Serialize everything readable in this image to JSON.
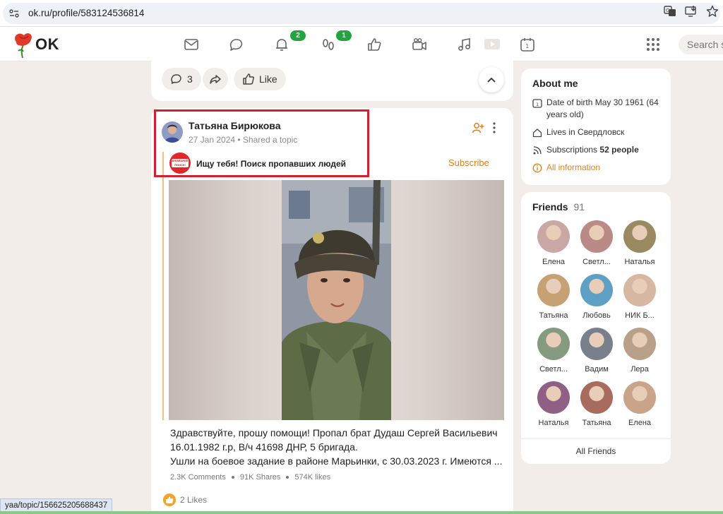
{
  "browser": {
    "url": "ok.ru/profile/583124536814",
    "status_url": "yaa/topic/156625205688437"
  },
  "header": {
    "logo_text": "OK",
    "badges": {
      "notifications": "2",
      "guests": "1"
    },
    "search_placeholder": "Search s"
  },
  "prev_post": {
    "comments_count": "3",
    "like_label": "Like"
  },
  "post": {
    "author": "Татьяна Бирюкова",
    "meta": "27 Jan 2024 • Shared a topic",
    "group_name": "Ищу тебя! Поиск пропавших людей",
    "group_avatar_text": "ВНИМАНИЕ ПОИСК!",
    "subscribe_label": "Subscribe",
    "text_lines": [
      "Здравствуйте,  прошу помощи! Пропал брат Дудаш Сергей Васильевич",
      "16.01.1982 г.р,  В/ч 41698 ДНР, 5 бригада.",
      "Ушли на боевое задание в районе Марьинки, с 30.03.2023 г. Имеются ..."
    ],
    "comments": "2.3K Comments",
    "shares": "91K Shares",
    "likes_stat": "574K likes",
    "likes_count": "2 Likes"
  },
  "about": {
    "title": "About me",
    "birth": "Date of birth May 30 1961 (64 years old)",
    "lives": "Lives in Свердловск",
    "subscriptions_label": "Subscriptions",
    "subscriptions_count": "52 people",
    "all_info": "All information"
  },
  "friends": {
    "title": "Friends",
    "count": "91",
    "all_label": "All Friends",
    "items": [
      {
        "name": "Елена",
        "color": "#c9a7a5"
      },
      {
        "name": "Светл...",
        "color": "#b98a86"
      },
      {
        "name": "Наталья",
        "color": "#9a8a62"
      },
      {
        "name": "Татьяна",
        "color": "#c7a173"
      },
      {
        "name": "Любовь",
        "color": "#5e9fc4"
      },
      {
        "name": "НИК Б...",
        "color": "#d6b8a2"
      },
      {
        "name": "Светл...",
        "color": "#869a7f"
      },
      {
        "name": "Вадим",
        "color": "#7a7f8c"
      },
      {
        "name": "Лера",
        "color": "#b8a089"
      },
      {
        "name": "Наталья",
        "color": "#8f5f86"
      },
      {
        "name": "Татьяна",
        "color": "#a86c5e"
      },
      {
        "name": "Елена",
        "color": "#c9a38a"
      }
    ]
  },
  "colors": {
    "accent_orange": "#e0811a",
    "badge_green": "#23a43f",
    "highlight_red": "#d41f2e"
  }
}
